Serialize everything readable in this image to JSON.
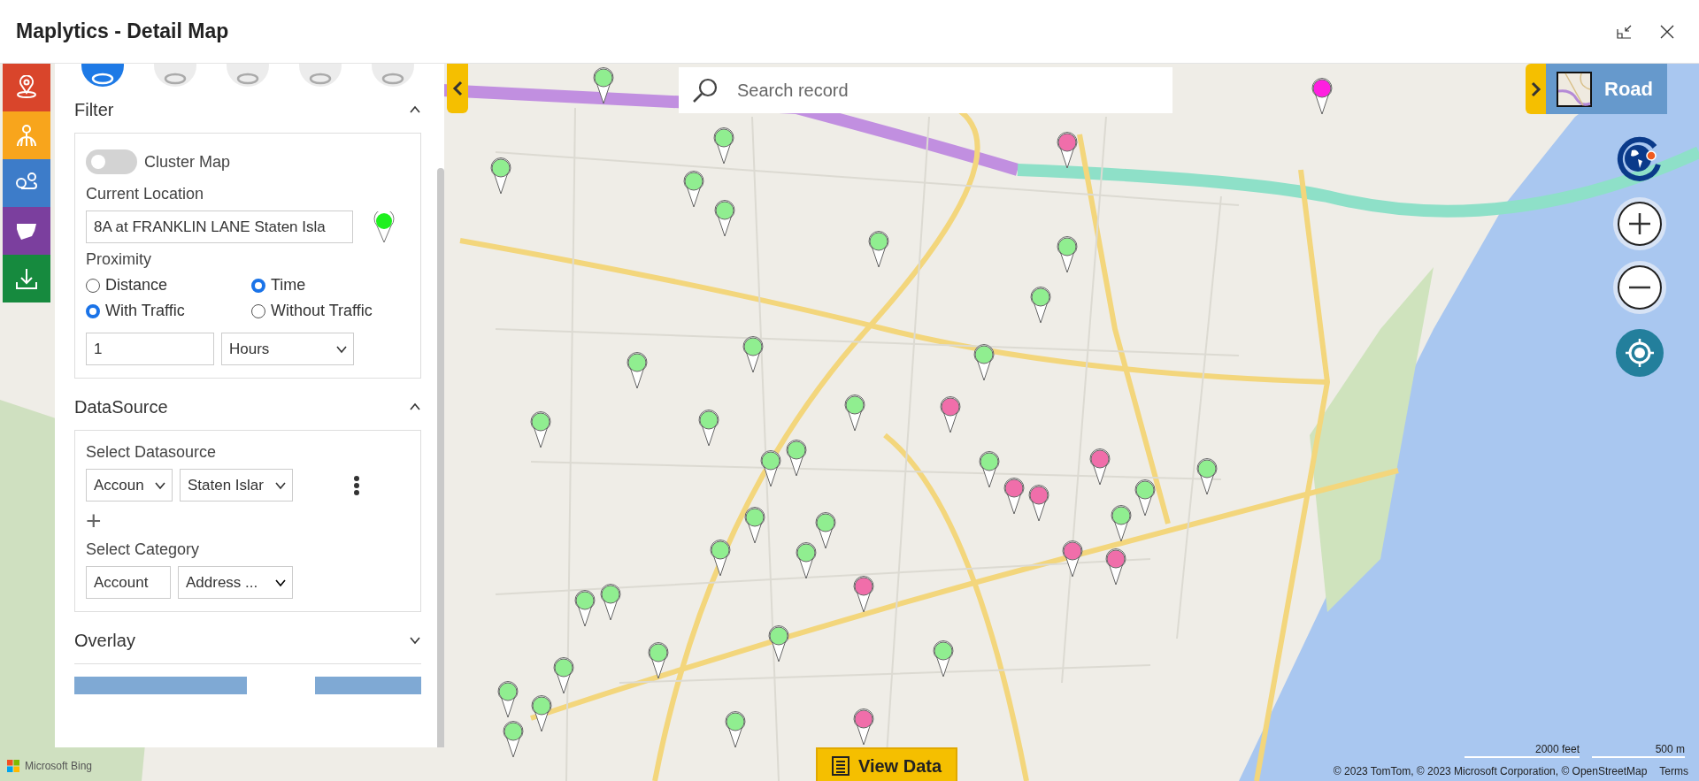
{
  "window": {
    "title": "Maplytics - Detail Map"
  },
  "side_tools": [
    {
      "color": "#d9452b"
    },
    {
      "color": "#f8a51c"
    },
    {
      "color": "#3d7cc9"
    },
    {
      "color": "#7b3f9e"
    },
    {
      "color": "#168a3e"
    }
  ],
  "panel_tabs": [
    {
      "selected": true
    },
    {
      "selected": false
    },
    {
      "selected": false
    },
    {
      "selected": false
    },
    {
      "selected": false
    }
  ],
  "filter": {
    "title": "Filter",
    "expanded": true,
    "cluster_label": "Cluster Map",
    "cluster_on": false,
    "location_label": "Current Location",
    "location_value": "8A at FRANKLIN LANE Staten Isla",
    "proximity_label": "Proximity",
    "proximity_options": [
      {
        "label": "Distance",
        "selected": false
      },
      {
        "label": "Time",
        "selected": true
      }
    ],
    "traffic_options": [
      {
        "label": "With Traffic",
        "selected": true
      },
      {
        "label": "Without Traffic",
        "selected": false
      }
    ],
    "amount": "1",
    "unit": "Hours"
  },
  "datasource": {
    "title": "DataSource",
    "expanded": true,
    "select_label": "Select Datasource",
    "entity": "Accoun",
    "view": "Staten Islar",
    "add": "+",
    "category_label": "Select Category",
    "category_entity": "Account",
    "category_field": "Address ..."
  },
  "overlay": {
    "title": "Overlay",
    "expanded": false
  },
  "search": {
    "placeholder": "Search record"
  },
  "map_style": {
    "label": "Road"
  },
  "view_data": {
    "label": "View Data"
  },
  "scale": [
    "2000 feet",
    "500 m"
  ],
  "attribution": "© 2023 TomTom, © 2023 Microsoft Corporation, © OpenStreetMap",
  "terms": "Terms",
  "provider": "Microsoft Bing",
  "pins": [
    {
      "color": "#90ee90"
    },
    {
      "color": "#90ee90"
    },
    {
      "color": "#90ee90"
    },
    {
      "color": "#90ee90"
    },
    {
      "color": "#90ee90"
    },
    {
      "color": "#90ee90"
    },
    {
      "color": "#90ee90"
    },
    {
      "color": "#90ee90"
    },
    {
      "color": "#90ee90"
    },
    {
      "color": "#90ee90"
    },
    {
      "color": "#90ee90"
    },
    {
      "color": "#90ee90"
    },
    {
      "color": "#90ee90"
    },
    {
      "color": "#90ee90"
    },
    {
      "color": "#90ee90"
    },
    {
      "color": "#90ee90"
    },
    {
      "color": "#90ee90"
    },
    {
      "color": "#90ee90"
    },
    {
      "color": "#90ee90"
    },
    {
      "color": "#90ee90"
    },
    {
      "color": "#90ee90"
    },
    {
      "color": "#90ee90"
    },
    {
      "color": "#90ee90"
    },
    {
      "color": "#90ee90"
    },
    {
      "color": "#90ee90"
    },
    {
      "color": "#90ee90"
    },
    {
      "color": "#90ee90"
    },
    {
      "color": "#90ee90"
    },
    {
      "color": "#90ee90"
    },
    {
      "color": "#90ee90"
    },
    {
      "color": "#90ee90"
    },
    {
      "color": "#90ee90"
    },
    {
      "color": "#90ee90"
    },
    {
      "color": "#90ee90"
    },
    {
      "color": "#ff1fe0"
    },
    {
      "color": "#f06eaa"
    },
    {
      "color": "#f06eaa"
    },
    {
      "color": "#f06eaa"
    },
    {
      "color": "#f06eaa"
    },
    {
      "color": "#f06eaa"
    },
    {
      "color": "#f06eaa"
    },
    {
      "color": "#f06eaa"
    },
    {
      "color": "#f06eaa"
    },
    {
      "color": "#f06eaa"
    }
  ]
}
